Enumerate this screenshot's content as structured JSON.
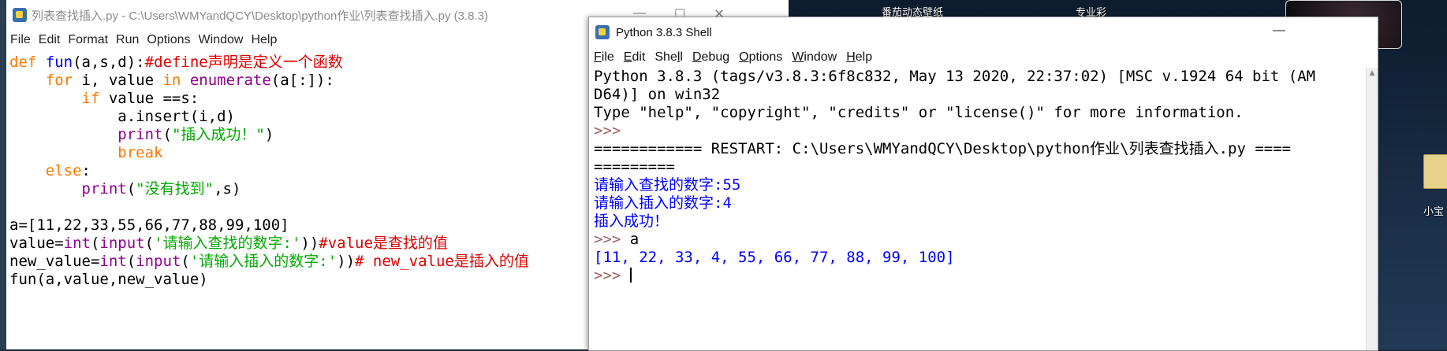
{
  "desktop": {
    "label_top_center": "番茄动态壁纸",
    "label_top_right": "专业彩",
    "label_icon": "小宝"
  },
  "editor": {
    "title": "列表查找插入.py - C:\\Users\\WMYandQCY\\Desktop\\python作业\\列表查找插入.py (3.8.3)",
    "menu": [
      "File",
      "Edit",
      "Format",
      "Run",
      "Options",
      "Window",
      "Help"
    ],
    "controls": {
      "minimize": "—",
      "maximize": "☐",
      "close": "✕"
    },
    "code": {
      "l1_def": "def",
      "l1_fn": "fun",
      "l1_args": "(a,s,d):",
      "l1_comment": "#define声明是定义一个函数",
      "l2_indent": "    ",
      "l2_for": "for",
      "l2_mid": " i, value ",
      "l2_in": "in",
      "l2_sp": " ",
      "l2_enum": "enumerate",
      "l2_end": "(a[:]):",
      "l3_indent": "        ",
      "l3_if": "if",
      "l3_rest": " value ==s:",
      "l4": "            a.insert(i,d)",
      "l5_indent": "            ",
      "l5_print": "print",
      "l5_open": "(",
      "l5_str": "\"插入成功！\"",
      "l5_close": ")",
      "l6_indent": "            ",
      "l6_break": "break",
      "l7_indent": "    ",
      "l7_else": "else",
      "l7_colon": ":",
      "l8_indent": "        ",
      "l8_print": "print",
      "l8_open": "(",
      "l8_str": "\"没有找到\"",
      "l8_rest": ",s)",
      "l10": "a=[11,22,33,55,66,77,88,99,100]",
      "l11_a": "value=",
      "l11_int": "int",
      "l11_b": "(",
      "l11_input": "input",
      "l11_c": "(",
      "l11_str": "'请输入查找的数字:'",
      "l11_d": "))",
      "l11_cm": "#value是查找的值",
      "l12_a": "new_value=",
      "l12_int": "int",
      "l12_b": "(",
      "l12_input": "input",
      "l12_c": "(",
      "l12_str": "'请输入插入的数字:'",
      "l12_d": "))",
      "l12_cm": "# new_value是插入的值",
      "l13": "fun(a,value,new_value)"
    }
  },
  "shell": {
    "title": "Python 3.8.3 Shell",
    "minimize": "—",
    "menu": [
      {
        "u": "F",
        "rest": "ile"
      },
      {
        "u": "E",
        "rest": "dit"
      },
      {
        "pre": "She",
        "u": "l",
        "rest": "l"
      },
      {
        "u": "D",
        "rest": "ebug"
      },
      {
        "u": "O",
        "rest": "ptions"
      },
      {
        "u": "W",
        "rest": "indow"
      },
      {
        "u": "H",
        "rest": "elp"
      }
    ],
    "lines": {
      "banner1": "Python 3.8.3 (tags/v3.8.3:6f8c832, May 13 2020, 22:37:02) [MSC v.1924 64 bit (AM",
      "banner2": "D64)] on win32",
      "banner3": "Type \"help\", \"copyright\", \"credits\" or \"license()\" for more information.",
      "prompt1": ">>>",
      "restart1": "============ RESTART: C:\\Users\\WMYandQCY\\Desktop\\python作业\\列表查找插入.py ====",
      "restart2": "=========",
      "out1": "请输入查找的数字:55",
      "out2": "请输入插入的数字:4",
      "out3": "插入成功！",
      "prompt2": ">>> ",
      "input2": "a",
      "out4": "[11, 22, 33, 4, 55, 66, 77, 88, 99, 100]",
      "prompt3": ">>> "
    }
  }
}
